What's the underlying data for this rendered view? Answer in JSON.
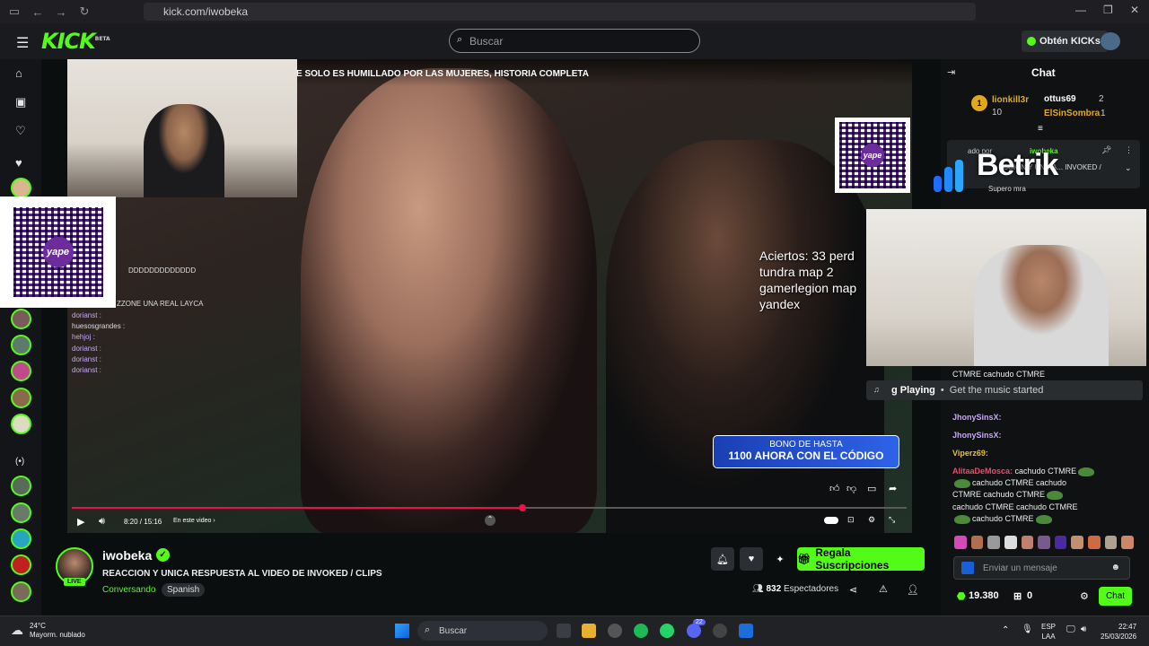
{
  "browser": {
    "url": "kick.com/iwobeka"
  },
  "nav": {
    "logo": "KICK",
    "logo_badge": "BETA",
    "search_placeholder": "Buscar",
    "kicks_button": "Obtén KICKs"
  },
  "video": {
    "overlay_title": "E SOLO ES HUMILLADO POR LAS MUJERES, HISTORIA COMPLETA",
    "aciertos_text": "Aciertos: 33 perd\ntundra map 2\ngamerlegion map\nyandex",
    "bono_line1": "BONO DE HASTA",
    "bono_line2": "1100 AHORA CON EL CÓDIGO",
    "yape_label": "yape",
    "overlay_chat": [
      {
        "user": "",
        "text": "DDDDDDDDDDDDD"
      },
      {
        "user": "",
        "text": "ZZONE UNA REAL LAYCA"
      },
      {
        "user": "dorianst :",
        "text": ""
      },
      {
        "user": "huesosgrandes :",
        "text": ""
      },
      {
        "user": "hehjoj :",
        "text": ""
      },
      {
        "user": "dorianst :",
        "text": ""
      },
      {
        "user": "dorianst :",
        "text": ""
      },
      {
        "user": "dorianst :",
        "text": ""
      }
    ],
    "time": "8:20 / 15:16",
    "en_este_video": "En este video ›",
    "progress": 0.54
  },
  "channel": {
    "name": "iwobeka",
    "live": "LIVE",
    "title": "REACCION Y UNICA RESPUESTA AL VIDEO DE INVOKED / CLIPS",
    "category": "Conversando",
    "tag": "Spanish",
    "subscribe_button": "Regala Suscripciones",
    "viewers_count": "832",
    "viewers_label": "Espectadores"
  },
  "chat": {
    "title": "Chat",
    "leaderboard": [
      {
        "rank": "1",
        "user": "lionkill3r",
        "count": "10"
      },
      {
        "rank": "",
        "user": "ottus69",
        "count": "2"
      },
      {
        "rank": "",
        "user": "ElSinSombra",
        "count": "1"
      }
    ],
    "pinned_by": "ado por",
    "pinned_user": "iwobeka",
    "pinned_text": "ICCION Y UNICA... INVOKED /",
    "pinned_extra": "Supero mra",
    "betrik": "Betrik",
    "now_playing_label": "g Playing",
    "now_playing_text": "Get the music started",
    "messages": [
      {
        "user": "",
        "text": "CTMRE cachudo CTMRE"
      },
      {
        "user": "JhonySinsX:",
        "text": ""
      },
      {
        "user": "JhonySinsX:",
        "text": ""
      },
      {
        "user": "Viperz69:",
        "text": ""
      },
      {
        "user": "AlitaaDeMosca:",
        "text": "cachudo CTMRE"
      },
      {
        "user": "",
        "text": "cachudo CTMRE cachudo"
      },
      {
        "user": "",
        "text": "CTMRE cachudo CTMRE"
      },
      {
        "user": "",
        "text": "cachudo CTMRE cachudo CTMRE"
      },
      {
        "user": "",
        "text": "cachudo CTMRE"
      }
    ],
    "input_placeholder": "Enviar un mensaje",
    "points": "19.380",
    "gifts": "0",
    "chat_button": "Chat"
  },
  "taskbar": {
    "temp": "24°C",
    "weather": "Mayorm. nublado",
    "search": "Buscar",
    "lang1": "ESP",
    "lang2": "LAA",
    "time": "22:47",
    "date": "25/03/2026",
    "badge_count": "22"
  },
  "colors": {
    "brand": "#53fc18",
    "progress": "#e8134a",
    "yape": "#6c2c9b",
    "bono": "#2f62e8"
  }
}
